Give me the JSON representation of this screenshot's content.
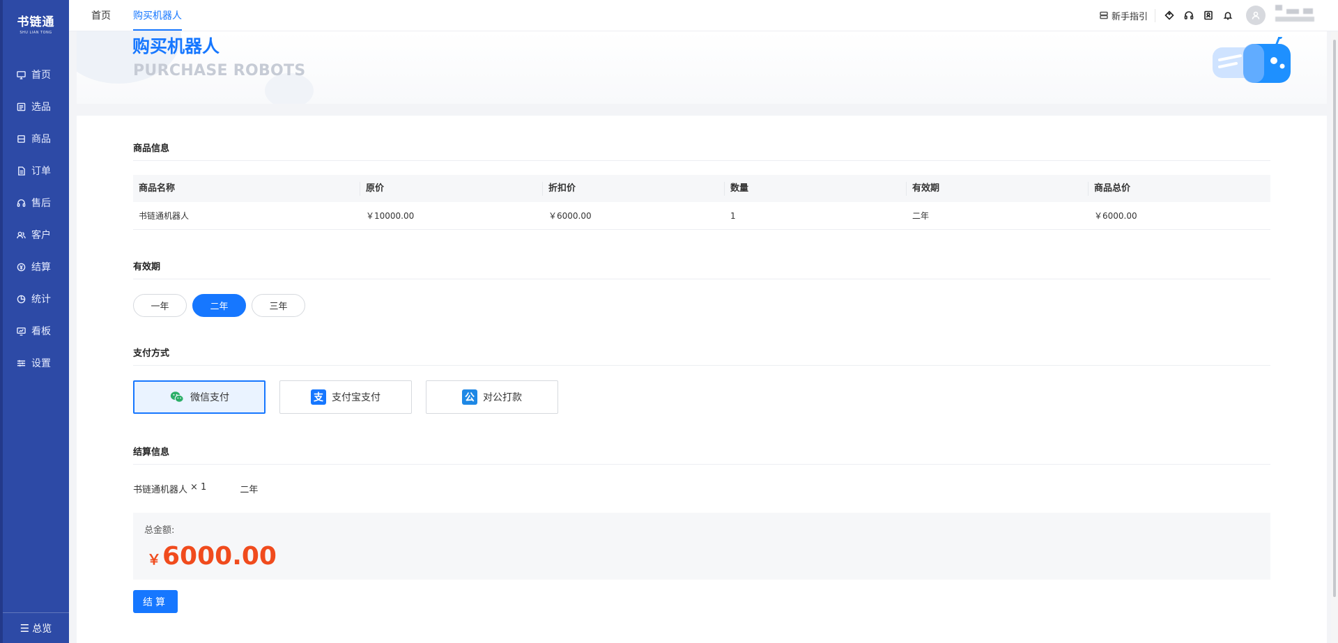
{
  "app": {
    "logo_main": "书链通",
    "logo_sub": "SHU LIAN TONG"
  },
  "sidebar": {
    "items": [
      {
        "label": "首页",
        "icon": "monitor-icon"
      },
      {
        "label": "选品",
        "icon": "checklist-icon"
      },
      {
        "label": "商品",
        "icon": "box-icon"
      },
      {
        "label": "订单",
        "icon": "document-icon"
      },
      {
        "label": "售后",
        "icon": "headset-icon"
      },
      {
        "label": "客户",
        "icon": "users-icon"
      },
      {
        "label": "结算",
        "icon": "settle-icon"
      },
      {
        "label": "统计",
        "icon": "pie-chart-icon"
      },
      {
        "label": "看板",
        "icon": "dashboard-icon"
      },
      {
        "label": "设置",
        "icon": "sliders-icon"
      }
    ],
    "bottom_label": "总览"
  },
  "header": {
    "tabs": [
      {
        "label": "首页",
        "active": false
      },
      {
        "label": "购买机器人",
        "active": true
      }
    ],
    "guide_label": "新手指引",
    "accent": "#1677ff"
  },
  "banner": {
    "title": "购买机器人",
    "subtitle": "PURCHASE ROBOTS"
  },
  "product_section": {
    "title": "商品信息",
    "columns": [
      "商品名称",
      "原价",
      "折扣价",
      "数量",
      "有效期",
      "商品总价"
    ],
    "rows": [
      [
        "书链通机器人",
        "￥10000.00",
        "￥6000.00",
        "1",
        "二年",
        "￥6000.00"
      ]
    ]
  },
  "validity_section": {
    "title": "有效期",
    "options": [
      {
        "label": "一年",
        "selected": false
      },
      {
        "label": "二年",
        "selected": true
      },
      {
        "label": "三年",
        "selected": false
      }
    ]
  },
  "payment_section": {
    "title": "支付方式",
    "options": [
      {
        "label": "微信支付",
        "icon": "wechat-icon",
        "selected": true
      },
      {
        "label": "支付宝支付",
        "icon": "alipay-icon",
        "icon_char": "支",
        "selected": false
      },
      {
        "label": "对公打款",
        "icon": "corporate-transfer-icon",
        "icon_char": "公",
        "selected": false
      }
    ]
  },
  "settlement_section": {
    "title": "结算信息",
    "item_name": "书链通机器人",
    "item_qty": "× 1",
    "item_period": "二年",
    "total_label": "总金额:",
    "total_currency": "￥",
    "total_amount": "6000.00",
    "total_color": "#f04b1d",
    "checkout_label": "结算"
  }
}
